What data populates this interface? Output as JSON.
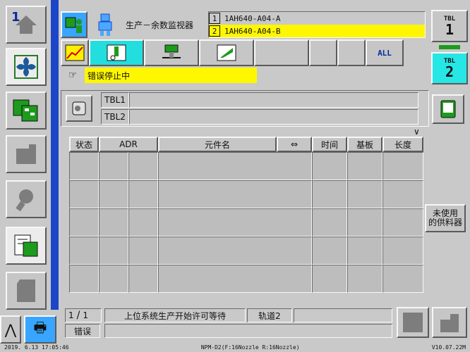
{
  "left_nav": {
    "items": [
      {
        "name": "home",
        "icon": "home-icon",
        "label": "1"
      },
      {
        "name": "production",
        "icon": "fan-icon",
        "label": ""
      },
      {
        "name": "board",
        "icon": "board-icon",
        "label": ""
      },
      {
        "name": "blank1",
        "icon": "block-icon",
        "label": ""
      },
      {
        "name": "tools",
        "icon": "wrench-icon",
        "label": ""
      },
      {
        "name": "feeder",
        "icon": "feeder-icon",
        "label": ""
      },
      {
        "name": "blank2",
        "icon": "block-icon",
        "label": ""
      }
    ],
    "up_arrow": "⋀",
    "printer": "🖶"
  },
  "header": {
    "title": "生产－余数监视器",
    "app_icon": "monitor-person-icon",
    "robot_icon": "robot-icon"
  },
  "program": {
    "rows": [
      {
        "num": "1",
        "name": "1AH640-A04-A"
      },
      {
        "num": "2",
        "name": "1AH640-A04-B"
      }
    ]
  },
  "tbl_buttons": [
    {
      "small": "TBL",
      "big": "1"
    },
    {
      "small": "TBL",
      "big": "2"
    }
  ],
  "toolbar": {
    "lane_all": "ALL"
  },
  "status": {
    "text": "错误停止中"
  },
  "tbl_panel": {
    "tbl1": "TBL1",
    "tbl2": "TBL2"
  },
  "table": {
    "columns": [
      "状态",
      "ADR",
      "元件名",
      "⇔",
      "时间",
      "基板",
      "长度"
    ],
    "row_count": 5,
    "scroll_mark": "∨"
  },
  "unused_feeder": {
    "line1": "未使用",
    "line2": "的供料器"
  },
  "bottom": {
    "page": "1",
    "page_total": "1",
    "error_label": "错误",
    "message": "上位系统生产开始许可等待",
    "lane": "轨道2"
  },
  "footer": {
    "datetime": "2019. 6.13 17:05:46",
    "machine": "NPM-D2(F:16Nozzle  R:16Nozzle)",
    "version": "V10.07.22M"
  },
  "colors": {
    "status_yellow": "#fff700",
    "active_cyan": "#22dede",
    "nav_blue": "#1c46c8",
    "app_blue": "#38a5ff"
  }
}
